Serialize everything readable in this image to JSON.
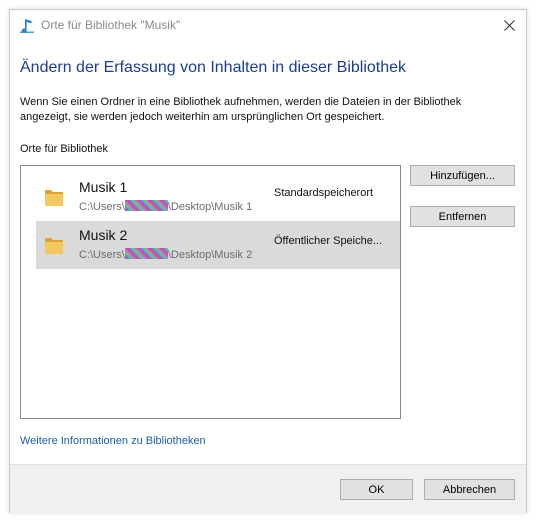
{
  "window": {
    "title": "Orte für Bibliothek \"Musik\""
  },
  "heading": "Ändern der Erfassung von Inhalten in dieser Bibliothek",
  "description": "Wenn Sie einen Ordner in eine Bibliothek aufnehmen, werden die Dateien in der Bibliothek angezeigt, sie werden jedoch weiterhin am ursprünglichen Ort gespeichert.",
  "section_label": "Orte für Bibliothek",
  "locations": [
    {
      "name": "Musik 1",
      "path_prefix": "C:\\Users\\",
      "path_suffix": "\\Desktop\\Musik 1",
      "status": "Standardspeicherort",
      "selected": false
    },
    {
      "name": "Musik 2",
      "path_prefix": "C:\\Users\\",
      "path_suffix": "\\Desktop\\Musik 2",
      "status": "Öffentlicher Speiche...",
      "selected": true
    }
  ],
  "buttons": {
    "add": "Hinzufügen...",
    "remove": "Entfernen",
    "ok": "OK",
    "cancel": "Abbrechen"
  },
  "info_link": "Weitere Informationen zu Bibliotheken",
  "colors": {
    "heading": "#1b3d8c",
    "link": "#1a5fa8",
    "selection": "#dadada",
    "folder": "#e8b84a"
  },
  "icons": {
    "app": "music-note-icon",
    "close": "close-icon",
    "folder": "folder-icon"
  }
}
